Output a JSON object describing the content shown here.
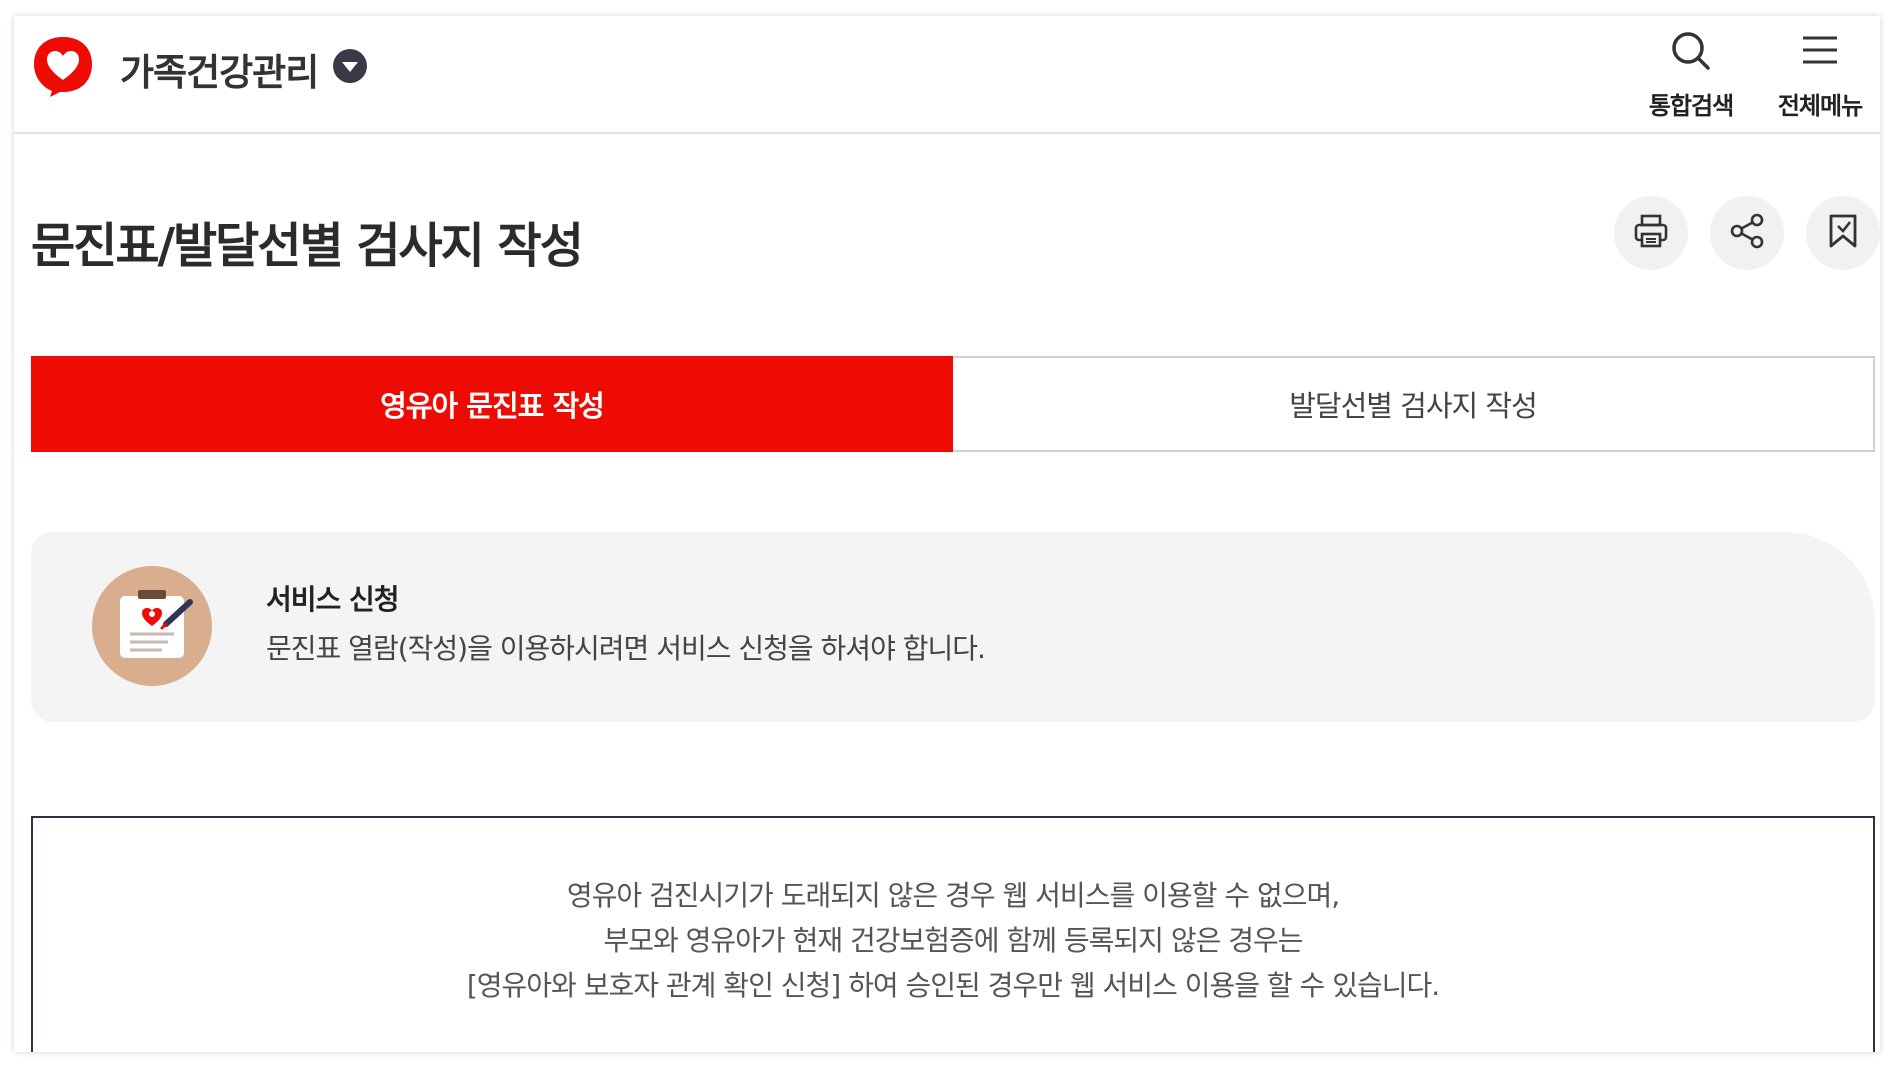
{
  "header": {
    "site_title": "가족건강관리",
    "search_label": "통합검색",
    "menu_label": "전체메뉴",
    "brand_color": "#ee0b03"
  },
  "page": {
    "title": "문진표/발달선별 검사지 작성"
  },
  "tabs": [
    {
      "label": "영유아 문진표 작성",
      "active": true
    },
    {
      "label": "발달선별 검사지 작성",
      "active": false
    }
  ],
  "service": {
    "title": "서비스 신청",
    "description": "문진표 열람(작성)을 이용하시려면 서비스 신청을 하셔야 합니다."
  },
  "notice": {
    "lines": [
      "영유아 검진시기가 도래되지 않은 경우 웹 서비스를 이용할 수 없으며,",
      "부모와 영유아가 현재 건강보험증에 함께 등록되지 않은 경우는",
      "[영유아와 보호자 관계 확인 신청] 하여 승인된 경우만 웹 서비스 이용을 할 수 있습니다."
    ]
  },
  "icons": {
    "logo": "heart-logo-icon",
    "dropdown": "chevron-down-icon",
    "search": "search-icon",
    "menu": "hamburger-menu-icon",
    "print": "print-icon",
    "share": "share-icon",
    "bookmark": "bookmark-icon",
    "service": "clipboard-icon"
  }
}
